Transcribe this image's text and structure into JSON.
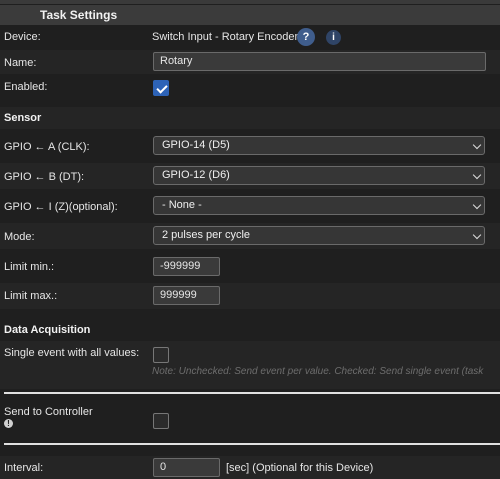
{
  "header": {
    "title": "Task Settings"
  },
  "device": {
    "label": "Device:",
    "value": "Switch Input - Rotary Encoder",
    "help_icon": "question-icon",
    "info_icon": "info-icon"
  },
  "name": {
    "label": "Name:",
    "value": "Rotary"
  },
  "enabled": {
    "label": "Enabled:",
    "checked": true
  },
  "sensor": {
    "title": "Sensor",
    "gpio_a": {
      "label": "GPIO ← A (CLK):",
      "selected": "GPIO-14 (D5)"
    },
    "gpio_b": {
      "label": "GPIO ← B (DT):",
      "selected": "GPIO-12 (D6)"
    },
    "gpio_i": {
      "label": "GPIO ← I (Z)(optional):",
      "selected": "- None -"
    },
    "mode": {
      "label": "Mode:",
      "selected": "2 pulses per cycle"
    },
    "limit_min": {
      "label": "Limit min.:",
      "value": "-999999"
    },
    "limit_max": {
      "label": "Limit max.:",
      "value": "999999"
    }
  },
  "acquisition": {
    "title": "Data Acquisition",
    "single_event": {
      "label": "Single event with all values:",
      "checked": false,
      "note": "Note: Unchecked: Send event per value. Checked: Send single event (task"
    },
    "send_controller": {
      "label": "Send to Controller",
      "checked": false
    },
    "interval": {
      "label": "Interval:",
      "value": "0",
      "suffix": "[sec] (Optional for this Device)"
    }
  }
}
